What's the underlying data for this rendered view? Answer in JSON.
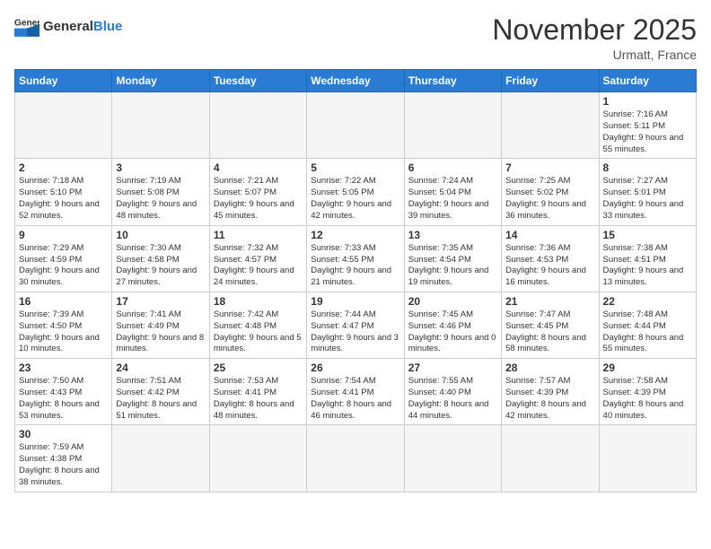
{
  "header": {
    "logo_general": "General",
    "logo_blue": "Blue",
    "month_title": "November 2025",
    "location": "Urmatt, France"
  },
  "weekdays": [
    "Sunday",
    "Monday",
    "Tuesday",
    "Wednesday",
    "Thursday",
    "Friday",
    "Saturday"
  ],
  "weeks": [
    [
      {
        "day": "",
        "info": ""
      },
      {
        "day": "",
        "info": ""
      },
      {
        "day": "",
        "info": ""
      },
      {
        "day": "",
        "info": ""
      },
      {
        "day": "",
        "info": ""
      },
      {
        "day": "",
        "info": ""
      },
      {
        "day": "1",
        "info": "Sunrise: 7:16 AM\nSunset: 5:11 PM\nDaylight: 9 hours and 55 minutes."
      }
    ],
    [
      {
        "day": "2",
        "info": "Sunrise: 7:18 AM\nSunset: 5:10 PM\nDaylight: 9 hours and 52 minutes."
      },
      {
        "day": "3",
        "info": "Sunrise: 7:19 AM\nSunset: 5:08 PM\nDaylight: 9 hours and 48 minutes."
      },
      {
        "day": "4",
        "info": "Sunrise: 7:21 AM\nSunset: 5:07 PM\nDaylight: 9 hours and 45 minutes."
      },
      {
        "day": "5",
        "info": "Sunrise: 7:22 AM\nSunset: 5:05 PM\nDaylight: 9 hours and 42 minutes."
      },
      {
        "day": "6",
        "info": "Sunrise: 7:24 AM\nSunset: 5:04 PM\nDaylight: 9 hours and 39 minutes."
      },
      {
        "day": "7",
        "info": "Sunrise: 7:25 AM\nSunset: 5:02 PM\nDaylight: 9 hours and 36 minutes."
      },
      {
        "day": "8",
        "info": "Sunrise: 7:27 AM\nSunset: 5:01 PM\nDaylight: 9 hours and 33 minutes."
      }
    ],
    [
      {
        "day": "9",
        "info": "Sunrise: 7:29 AM\nSunset: 4:59 PM\nDaylight: 9 hours and 30 minutes."
      },
      {
        "day": "10",
        "info": "Sunrise: 7:30 AM\nSunset: 4:58 PM\nDaylight: 9 hours and 27 minutes."
      },
      {
        "day": "11",
        "info": "Sunrise: 7:32 AM\nSunset: 4:57 PM\nDaylight: 9 hours and 24 minutes."
      },
      {
        "day": "12",
        "info": "Sunrise: 7:33 AM\nSunset: 4:55 PM\nDaylight: 9 hours and 21 minutes."
      },
      {
        "day": "13",
        "info": "Sunrise: 7:35 AM\nSunset: 4:54 PM\nDaylight: 9 hours and 19 minutes."
      },
      {
        "day": "14",
        "info": "Sunrise: 7:36 AM\nSunset: 4:53 PM\nDaylight: 9 hours and 16 minutes."
      },
      {
        "day": "15",
        "info": "Sunrise: 7:38 AM\nSunset: 4:51 PM\nDaylight: 9 hours and 13 minutes."
      }
    ],
    [
      {
        "day": "16",
        "info": "Sunrise: 7:39 AM\nSunset: 4:50 PM\nDaylight: 9 hours and 10 minutes."
      },
      {
        "day": "17",
        "info": "Sunrise: 7:41 AM\nSunset: 4:49 PM\nDaylight: 9 hours and 8 minutes."
      },
      {
        "day": "18",
        "info": "Sunrise: 7:42 AM\nSunset: 4:48 PM\nDaylight: 9 hours and 5 minutes."
      },
      {
        "day": "19",
        "info": "Sunrise: 7:44 AM\nSunset: 4:47 PM\nDaylight: 9 hours and 3 minutes."
      },
      {
        "day": "20",
        "info": "Sunrise: 7:45 AM\nSunset: 4:46 PM\nDaylight: 9 hours and 0 minutes."
      },
      {
        "day": "21",
        "info": "Sunrise: 7:47 AM\nSunset: 4:45 PM\nDaylight: 8 hours and 58 minutes."
      },
      {
        "day": "22",
        "info": "Sunrise: 7:48 AM\nSunset: 4:44 PM\nDaylight: 8 hours and 55 minutes."
      }
    ],
    [
      {
        "day": "23",
        "info": "Sunrise: 7:50 AM\nSunset: 4:43 PM\nDaylight: 8 hours and 53 minutes."
      },
      {
        "day": "24",
        "info": "Sunrise: 7:51 AM\nSunset: 4:42 PM\nDaylight: 8 hours and 51 minutes."
      },
      {
        "day": "25",
        "info": "Sunrise: 7:53 AM\nSunset: 4:41 PM\nDaylight: 8 hours and 48 minutes."
      },
      {
        "day": "26",
        "info": "Sunrise: 7:54 AM\nSunset: 4:41 PM\nDaylight: 8 hours and 46 minutes."
      },
      {
        "day": "27",
        "info": "Sunrise: 7:55 AM\nSunset: 4:40 PM\nDaylight: 8 hours and 44 minutes."
      },
      {
        "day": "28",
        "info": "Sunrise: 7:57 AM\nSunset: 4:39 PM\nDaylight: 8 hours and 42 minutes."
      },
      {
        "day": "29",
        "info": "Sunrise: 7:58 AM\nSunset: 4:39 PM\nDaylight: 8 hours and 40 minutes."
      }
    ],
    [
      {
        "day": "30",
        "info": "Sunrise: 7:59 AM\nSunset: 4:38 PM\nDaylight: 8 hours and 38 minutes."
      },
      {
        "day": "",
        "info": ""
      },
      {
        "day": "",
        "info": ""
      },
      {
        "day": "",
        "info": ""
      },
      {
        "day": "",
        "info": ""
      },
      {
        "day": "",
        "info": ""
      },
      {
        "day": "",
        "info": ""
      }
    ]
  ]
}
